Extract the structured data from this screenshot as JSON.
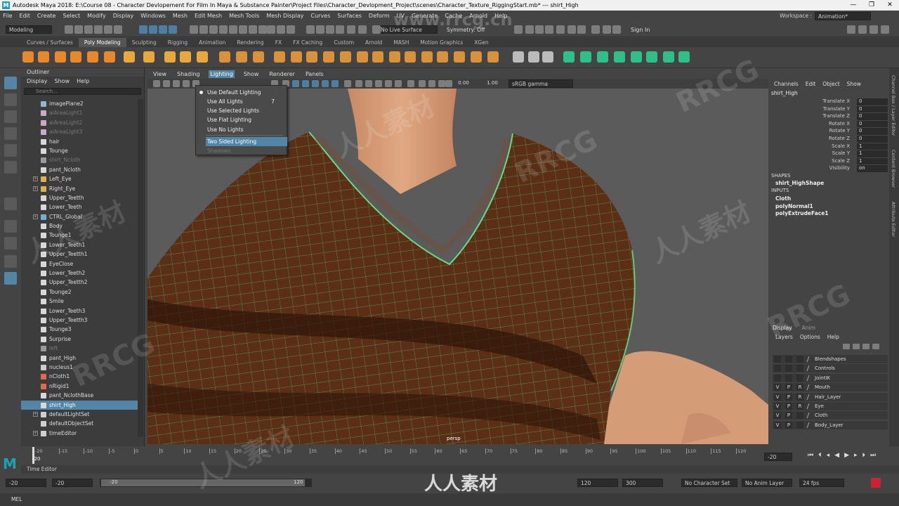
{
  "window": {
    "title": "Autodesk Maya 2018: E:\\Course 08 - Character Devlopement For Film In Maya & Substance Painter\\Project Files\\Character_Devlopment_Project\\scenes\\Character_Texture_RiggingStart.mb*  ---  shirt_High",
    "controls": [
      "—",
      "❐",
      "✕"
    ]
  },
  "menubar": [
    "File",
    "Edit",
    "Create",
    "Select",
    "Modify",
    "Display",
    "Windows",
    "Mesh",
    "Edit Mesh",
    "Mesh Tools",
    "Mesh Display",
    "Curves",
    "Surfaces",
    "Deform",
    "UV",
    "Generate",
    "Cache",
    "Arnold",
    "Help"
  ],
  "workspace": {
    "label": "Workspace :",
    "value": "Animation*"
  },
  "statusline": {
    "mode": "Modeling",
    "live_surface": "No Live Surface",
    "symmetry": "Symmetry: Off",
    "sign_in": "Sign In"
  },
  "shelf_tabs": [
    "Curves / Surfaces",
    "Poly Modeling",
    "Sculpting",
    "Rigging",
    "Animation",
    "Rendering",
    "FX",
    "FX Caching",
    "Custom",
    "Arnold",
    "MASH",
    "Motion Graphics",
    "XGen"
  ],
  "shelf_active": "Poly Modeling",
  "outliner": {
    "title": "Outliner",
    "menus": [
      "Display",
      "Show",
      "Help"
    ],
    "search_placeholder": "Search...",
    "items": [
      {
        "label": "imagePlane2",
        "dim": false,
        "expand": false,
        "icon": "#8fb7d0"
      },
      {
        "label": "aiAreaLight1",
        "dim": true,
        "expand": false,
        "icon": "#c9a8c8"
      },
      {
        "label": "aiAreaLight2",
        "dim": true,
        "expand": false,
        "icon": "#c9a8c8"
      },
      {
        "label": "aiAreaLight3",
        "dim": true,
        "expand": false,
        "icon": "#c9a8c8"
      },
      {
        "label": "hair",
        "dim": false,
        "expand": false,
        "icon": "#d8d8d8"
      },
      {
        "label": "Tounge",
        "dim": false,
        "expand": false,
        "icon": "#d8d8d8"
      },
      {
        "label": "shirt_Ncloth",
        "dim": true,
        "expand": false,
        "icon": "#9a9a9a"
      },
      {
        "label": "pant_Ncloth",
        "dim": false,
        "expand": false,
        "icon": "#d8d8d8"
      },
      {
        "label": "Left_Eye",
        "dim": false,
        "expand": true,
        "icon": "#e0b04a"
      },
      {
        "label": "Right_Eye",
        "dim": false,
        "expand": true,
        "icon": "#e0b04a"
      },
      {
        "label": "Upper_Teetth",
        "dim": false,
        "expand": false,
        "icon": "#d8d8d8"
      },
      {
        "label": "Lower_Teeth",
        "dim": false,
        "expand": false,
        "icon": "#d8d8d8"
      },
      {
        "label": "CTRL_Global",
        "dim": false,
        "expand": true,
        "icon": "#6fb0d8"
      },
      {
        "label": "Body",
        "dim": false,
        "expand": false,
        "icon": "#d8d8d8"
      },
      {
        "label": "Tounge1",
        "dim": false,
        "expand": false,
        "icon": "#d8d8d8"
      },
      {
        "label": "Lower_Teeth1",
        "dim": false,
        "expand": false,
        "icon": "#d8d8d8"
      },
      {
        "label": "Upper_Teetth1",
        "dim": false,
        "expand": false,
        "icon": "#d8d8d8"
      },
      {
        "label": "EyeClose",
        "dim": false,
        "expand": false,
        "icon": "#d8d8d8"
      },
      {
        "label": "Lower_Teeth2",
        "dim": false,
        "expand": false,
        "icon": "#d8d8d8"
      },
      {
        "label": "Upper_Teetth2",
        "dim": false,
        "expand": false,
        "icon": "#d8d8d8"
      },
      {
        "label": "Tounge2",
        "dim": false,
        "expand": false,
        "icon": "#d8d8d8"
      },
      {
        "label": "Smile",
        "dim": false,
        "expand": false,
        "icon": "#d8d8d8"
      },
      {
        "label": "Lower_Teeth3",
        "dim": false,
        "expand": false,
        "icon": "#d8d8d8"
      },
      {
        "label": "Upper_Teetth3",
        "dim": false,
        "expand": false,
        "icon": "#d8d8d8"
      },
      {
        "label": "Tounge3",
        "dim": false,
        "expand": false,
        "icon": "#d8d8d8"
      },
      {
        "label": "Surprise",
        "dim": false,
        "expand": false,
        "icon": "#d8d8d8"
      },
      {
        "label": "left",
        "dim": true,
        "expand": false,
        "icon": "#9a9a9a"
      },
      {
        "label": "pant_High",
        "dim": false,
        "expand": false,
        "icon": "#d8d8d8"
      },
      {
        "label": "nucleus1",
        "dim": false,
        "expand": false,
        "icon": "#cccccc"
      },
      {
        "label": "nCloth1",
        "dim": false,
        "expand": false,
        "icon": "#e06a4a"
      },
      {
        "label": "nRigid1",
        "dim": false,
        "expand": false,
        "icon": "#e06a4a"
      },
      {
        "label": "pant_NclothBase",
        "dim": false,
        "expand": false,
        "icon": "#d8d8d8"
      },
      {
        "label": "shirt_High",
        "dim": false,
        "expand": false,
        "icon": "#d8d8d8",
        "selected": true
      },
      {
        "label": "defaultLightSet",
        "dim": false,
        "expand": true,
        "icon": "#cfcfcf"
      },
      {
        "label": "defaultObjectSet",
        "dim": false,
        "expand": false,
        "icon": "#cfcfcf"
      },
      {
        "label": "timeEditor",
        "dim": false,
        "expand": true,
        "icon": "#cfcfcf"
      }
    ]
  },
  "viewport": {
    "menus": [
      "View",
      "Shading",
      "Lighting",
      "Show",
      "Renderer",
      "Panels"
    ],
    "open_menu": "Lighting",
    "toolbar_values": {
      "exposure": "0.00",
      "gamma": "1.00",
      "colorspace": "sRGB gamma"
    },
    "camera_label": "persp"
  },
  "lighting_menu": {
    "items": [
      {
        "label": "Use Default Lighting",
        "radio": true,
        "shortcut": ""
      },
      {
        "label": "Use All Lights",
        "radio": false,
        "shortcut": "7"
      },
      {
        "label": "Use Selected Lights",
        "radio": false,
        "shortcut": ""
      },
      {
        "label": "Use Flat Lighting",
        "radio": false,
        "shortcut": ""
      },
      {
        "label": "Use No Lights",
        "radio": false,
        "shortcut": ""
      },
      {
        "label": "Two Sided Lighting",
        "radio": false,
        "shortcut": "",
        "highlighted": true
      },
      {
        "label": "Shadows",
        "radio": false,
        "shortcut": "",
        "disabled": true
      }
    ]
  },
  "channel_box": {
    "menus": [
      "Channels",
      "Edit",
      "Object",
      "Show"
    ],
    "object": "shirt_High",
    "channels": [
      {
        "name": "Translate X",
        "value": "0"
      },
      {
        "name": "Translate Y",
        "value": "0"
      },
      {
        "name": "Translate Z",
        "value": "0"
      },
      {
        "name": "Rotate X",
        "value": "0"
      },
      {
        "name": "Rotate Y",
        "value": "0"
      },
      {
        "name": "Rotate Z",
        "value": "0"
      },
      {
        "name": "Scale X",
        "value": "1"
      },
      {
        "name": "Scale Y",
        "value": "1"
      },
      {
        "name": "Scale Z",
        "value": "1"
      },
      {
        "name": "Visibility",
        "value": "on"
      }
    ],
    "shapes_header": "SHAPES",
    "shape": "shirt_HighShape",
    "inputs_header": "INPUTS",
    "inputs": [
      "Cloth",
      "polyNormal1",
      "polyExtrudeFace1"
    ]
  },
  "layer_editor": {
    "tabs": [
      "Display",
      "Anim"
    ],
    "menus": [
      "Layers",
      "Options",
      "Help"
    ],
    "layers": [
      {
        "name": "Blendshapes",
        "v": "",
        "p": "",
        "r": ""
      },
      {
        "name": "Controls",
        "v": "",
        "p": "",
        "r": ""
      },
      {
        "name": "JointIK",
        "v": "",
        "p": "",
        "r": ""
      },
      {
        "name": "Mouth",
        "v": "V",
        "p": "P",
        "r": "R"
      },
      {
        "name": "Hair_Layer",
        "v": "V",
        "p": "P",
        "r": "R"
      },
      {
        "name": "Eye",
        "v": "V",
        "p": "P",
        "r": "R"
      },
      {
        "name": "Cloth",
        "v": "V",
        "p": "P",
        "r": ""
      },
      {
        "name": "Body_Layer",
        "v": "V",
        "p": "P",
        "r": ""
      }
    ]
  },
  "right_strip_labels": [
    "Channel Box / Layer Editor",
    "Content Browser",
    "Attribute Editor"
  ],
  "timeline": {
    "current_frame": "-20",
    "ticks": [
      "-20",
      "-15",
      "-10",
      "-5",
      "0",
      "5",
      "10",
      "15",
      "20",
      "25",
      "30",
      "35",
      "40",
      "45",
      "50",
      "55",
      "60",
      "65",
      "70",
      "75",
      "80",
      "85",
      "90",
      "95",
      "100",
      "105",
      "110",
      "115",
      "120"
    ],
    "frame_field": "-20"
  },
  "time_editor_label": "Time Editor",
  "range": {
    "start": "-20",
    "range_start": "-20",
    "slider_start": "-20",
    "slider_end": "120",
    "range_end": "120",
    "end": "300",
    "char_set": "No Character Set",
    "anim_layer": "No Anim Layer",
    "fps": "24 fps"
  },
  "command_line": {
    "label": "MEL"
  },
  "watermarks": [
    "www.rrcg.cn",
    "人人素材",
    "RRCG"
  ],
  "colors": {
    "accent": "#5285a6",
    "wireframe": "#6bff9a",
    "skin": "#d9a07a",
    "shirt": "#5b3018"
  }
}
